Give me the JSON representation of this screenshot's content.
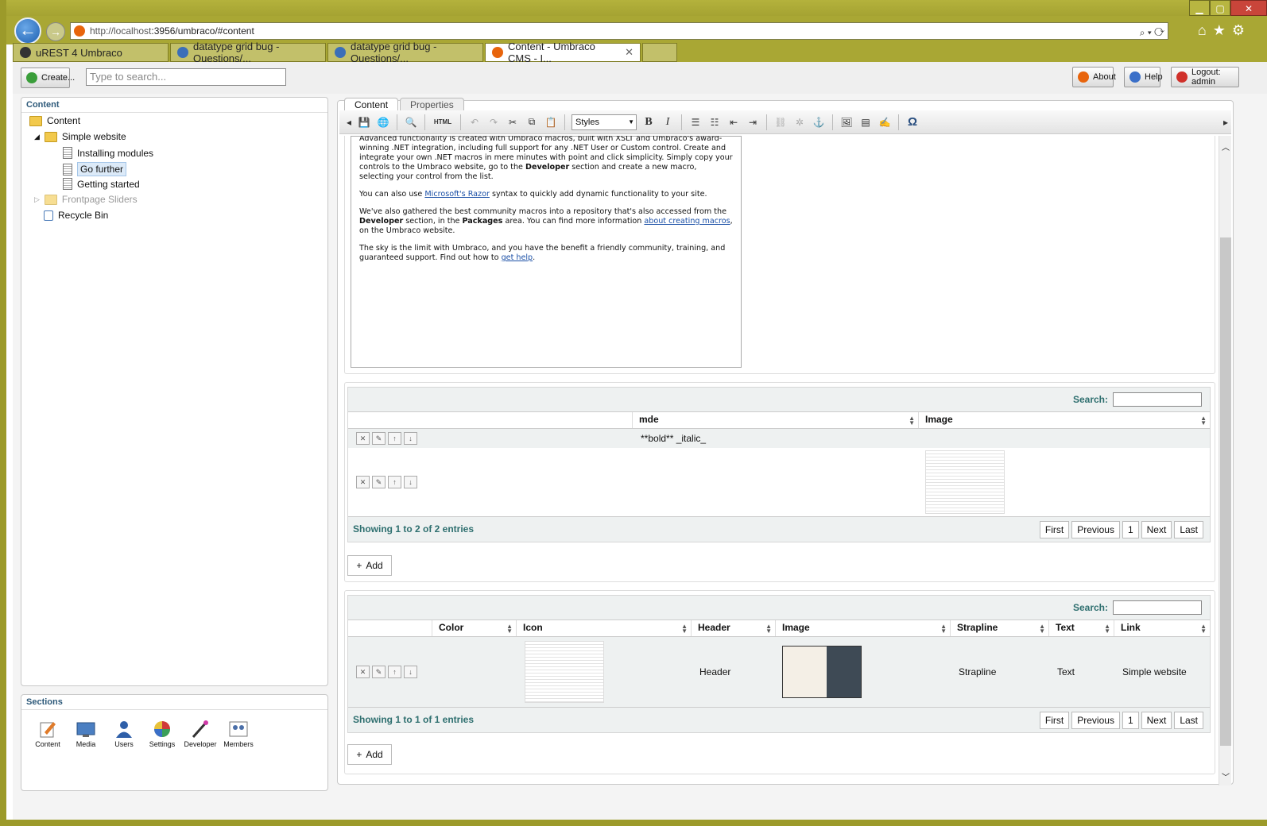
{
  "browser": {
    "url_host": "http://localhost",
    "url_rest": ":3956/umbraco/#content",
    "tabs": [
      {
        "label": "uREST 4 Umbraco"
      },
      {
        "label": "datatype grid bug - Questions/..."
      },
      {
        "label": "datatype grid bug - Questions/..."
      },
      {
        "label": "Content - Umbraco CMS - I...",
        "close": "✕"
      }
    ],
    "window_buttons": {
      "minimize": "▁",
      "maximize": "▢",
      "close": "✕"
    }
  },
  "topbar": {
    "create_label": "Create...",
    "search_placeholder": "Type to search...",
    "about_label": "About",
    "help_label": "Help",
    "logout_label": "Logout: admin"
  },
  "tree": {
    "title": "Content",
    "items": [
      {
        "label": "Content"
      },
      {
        "label": "Simple website"
      },
      {
        "label": "Installing modules"
      },
      {
        "label": "Go further"
      },
      {
        "label": "Getting started"
      },
      {
        "label": "Frontpage Sliders"
      },
      {
        "label": "Recycle Bin"
      }
    ]
  },
  "sections": {
    "title": "Sections",
    "items": [
      {
        "label": "Content",
        "icon": "content-icon"
      },
      {
        "label": "Media",
        "icon": "media-icon"
      },
      {
        "label": "Users",
        "icon": "users-icon"
      },
      {
        "label": "Settings",
        "icon": "settings-icon"
      },
      {
        "label": "Developer",
        "icon": "developer-icon"
      },
      {
        "label": "Members",
        "icon": "members-icon"
      }
    ]
  },
  "editor_tabs": {
    "content": "Content",
    "properties": "Properties"
  },
  "toolbar": {
    "styles_label": "Styles",
    "html_label": "HTML",
    "bold": "B",
    "italic": "I",
    "omega": "Ω"
  },
  "editor": {
    "p1a": "Advanced functionality is created with Umbraco macros, built with XSLT and Umbraco's award-winning .NET integration, including full support for any .NET User or Custom control. Create and integrate your own .NET macros in mere minutes with point and click simplicity. Simply copy your controls to the Umbraco website, go to the ",
    "p1b": "Developer",
    "p1c": " section and create a new macro, selecting your control from the list.",
    "p2a": "You can also use ",
    "p2link": "Microsoft's Razor",
    "p2b": " syntax to quickly add dynamic functionality to your site.",
    "p3a": "We've also gathered the best community macros into a repository that's also accessed from the ",
    "p3b": "Developer",
    "p3c": " section, in the ",
    "p3d": "Packages",
    "p3e": " area. You can find more information ",
    "p3link": "about creating macros",
    "p3f": ", on the Umbraco website.",
    "p4a": "The sky is the limit with Umbraco, and you have the benefit a friendly community, training, and guaranteed support. Find out how to ",
    "p4link": "get help",
    "p4b": "."
  },
  "grid1": {
    "search_label": "Search:",
    "columns": [
      "",
      "mde",
      "Image"
    ],
    "rows": [
      {
        "mde": "**bold** _italic_"
      },
      {
        "mde": ""
      }
    ],
    "info": "Showing 1 to 2 of 2 entries",
    "pager": [
      "First",
      "Previous",
      "1",
      "Next",
      "Last"
    ],
    "add_label": "Add"
  },
  "grid2": {
    "search_label": "Search:",
    "columns": [
      "",
      "Color",
      "Icon",
      "Header",
      "Image",
      "Strapline",
      "Text",
      "Link"
    ],
    "row": {
      "header": "Header",
      "strapline": "Strapline",
      "text": "Text",
      "link": "Simple website"
    },
    "info": "Showing 1 to 1 of 1 entries",
    "pager": [
      "First",
      "Previous",
      "1",
      "Next",
      "Last"
    ],
    "add_label": "Add"
  },
  "row_buttons": {
    "delete": "✕",
    "edit": "✎",
    "up": "↑",
    "down": "↓"
  }
}
